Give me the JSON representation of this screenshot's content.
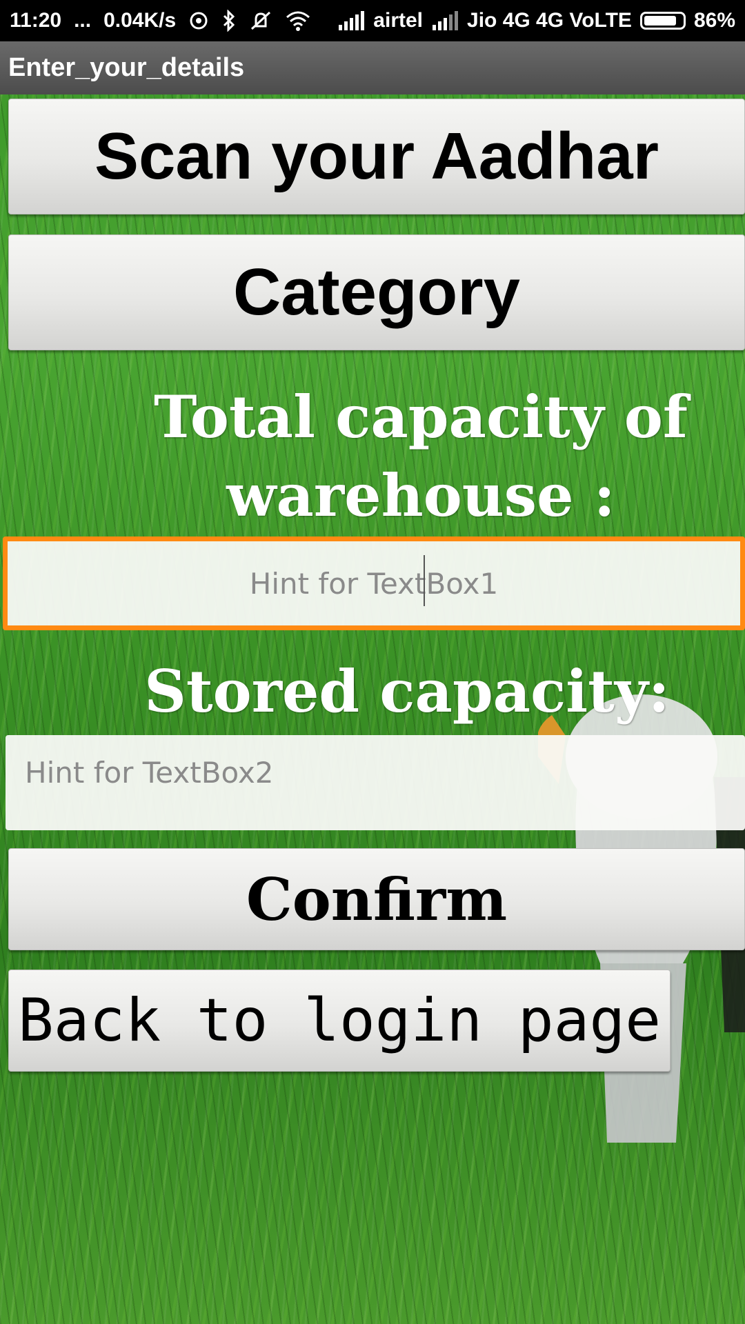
{
  "status_bar": {
    "time": "11:20",
    "dots": "...",
    "speed": "0.04K/s",
    "carrier1": "airtel",
    "carrier2": "Jio 4G 4G VoLTE",
    "battery": "86%",
    "battery_level": 0.86,
    "icons": [
      "hotspot-icon",
      "bluetooth-icon",
      "vibrate-off-icon",
      "wifi-icon",
      "signal-icon",
      "signal-icon",
      "battery-icon"
    ]
  },
  "app": {
    "title": "Enter_your_details"
  },
  "buttons": {
    "scan": "Scan your Aadhar",
    "category": "Category",
    "confirm": "Confirm",
    "back": "Back to login page"
  },
  "labels": {
    "total_capacity_line1": "Total capacity of",
    "total_capacity_line2": "warehouse :",
    "stored_capacity": "Stored capacity:"
  },
  "inputs": {
    "textbox1_placeholder": "Hint for TextBox1",
    "textbox2_placeholder": "Hint for TextBox2"
  },
  "colors": {
    "focus_border": "#ff8a12",
    "title_bar": "#5a5a5a",
    "status_bar": "#000000",
    "field": "#4aa532"
  }
}
